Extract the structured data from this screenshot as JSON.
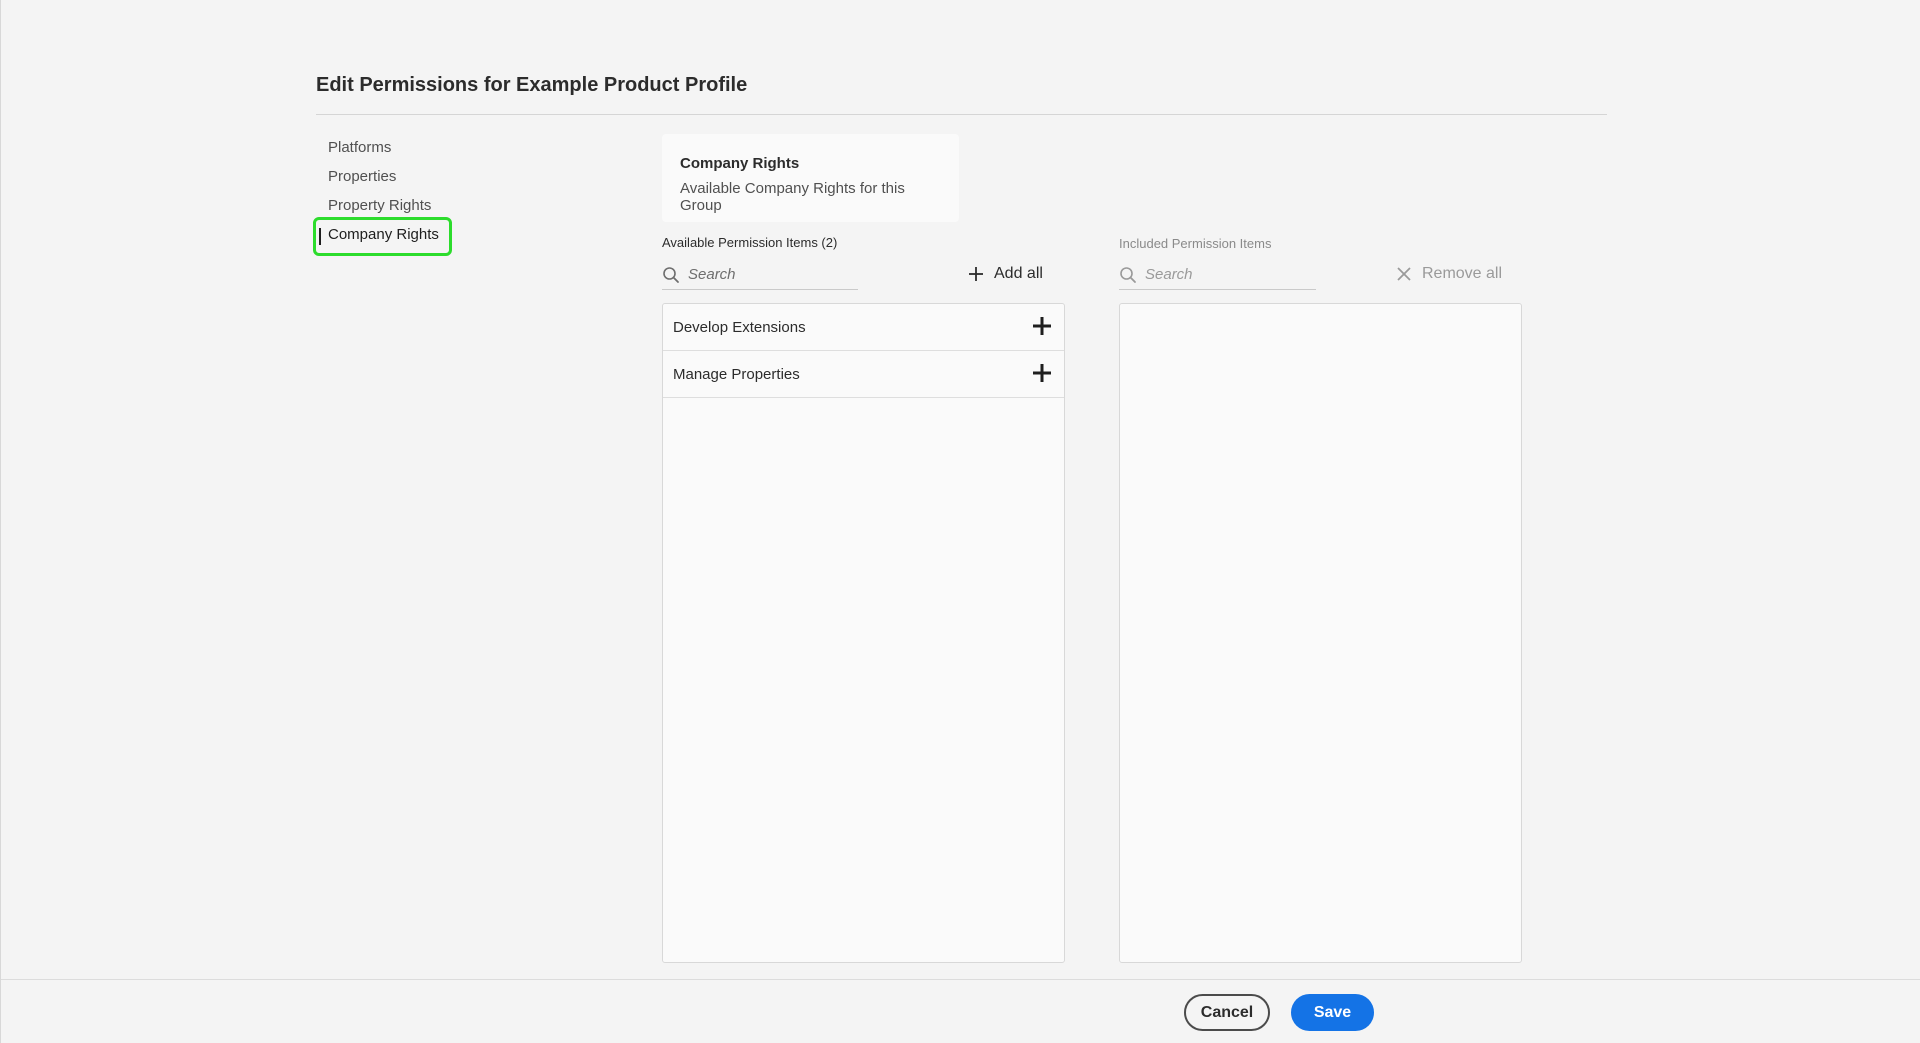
{
  "dialog": {
    "title": "Edit Permissions for Example Product Profile"
  },
  "nav": {
    "items": [
      {
        "label": "Platforms"
      },
      {
        "label": "Properties"
      },
      {
        "label": "Property Rights"
      },
      {
        "label": "Company Rights"
      }
    ],
    "active_item": "Company Rights"
  },
  "group_card": {
    "title": "Company Rights",
    "subtitle": "Available Company Rights for this Group"
  },
  "available": {
    "label": "Available Permission Items (2)",
    "search_placeholder": "Search",
    "add_all_label": "Add all",
    "items": [
      {
        "label": "Develop Extensions"
      },
      {
        "label": "Manage Properties"
      }
    ]
  },
  "included": {
    "label": "Included Permission Items",
    "search_placeholder": "Search",
    "remove_all_label": "Remove all",
    "items": []
  },
  "footer": {
    "cancel_label": "Cancel",
    "save_label": "Save"
  },
  "colors": {
    "accent": "#1473e6",
    "highlight": "#2cdc2c",
    "background": "#f4f4f4"
  },
  "icons": [
    "search-icon",
    "plus-icon",
    "close-icon"
  ]
}
